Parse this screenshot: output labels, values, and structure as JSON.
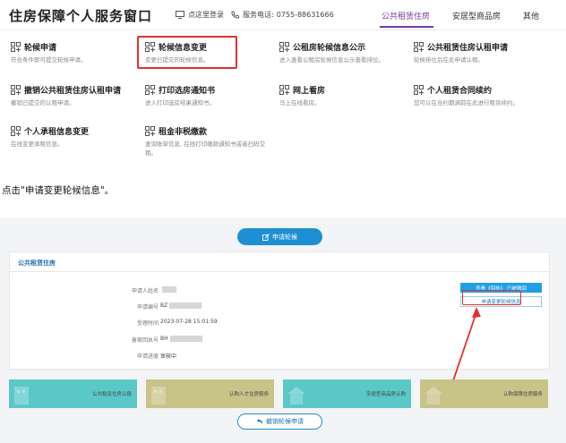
{
  "header": {
    "site_title": "住房保障个人服务窗口",
    "login_label": "点这里登录",
    "phone_label": "服务电话:",
    "phone_number": "0755-88631666",
    "tabs": [
      {
        "label": "公共租赁住房",
        "active": true
      },
      {
        "label": "安居型商品房",
        "active": false
      },
      {
        "label": "其他",
        "active": false
      }
    ]
  },
  "services": [
    {
      "title": "轮候申请",
      "desc": "符合条件即可提交轮候申请。"
    },
    {
      "title": "轮候信息变更",
      "desc": "变更已提交的轮候信息。"
    },
    {
      "title": "公租房轮候信息公示",
      "desc": "进入查看公租房轮候信息公示查看排位。"
    },
    {
      "title": "公共租赁住房认租申请",
      "desc": "轮候排位后在此申请认租。"
    },
    {
      "title": "撤销公共租赁住房认租申请",
      "desc": "撤销已提交的认租申请。"
    },
    {
      "title": "打印选房通知书",
      "desc": "进入打印选房结果通知书。"
    },
    {
      "title": "网上看房",
      "desc": "马上在线看房。"
    },
    {
      "title": "个人租赁合同续约",
      "desc": "您可以在合约期满前在此进行租赁续约。"
    },
    {
      "title": "个人承租信息变更",
      "desc": "在线变更承租信息。"
    },
    {
      "title": "租金非税缴款",
      "desc": "查询账单信息, 在线打印缴款通知书或者扫码交租。"
    }
  ],
  "instruction": "点击\"申请变更轮候信息\"。",
  "lower": {
    "apply_label": "申请轮候",
    "card_title": "公共租赁住房",
    "fields": [
      {
        "label": "申请人姓名",
        "value": ""
      },
      {
        "label": "申请编号",
        "value": "BZ"
      },
      {
        "label": "受理时间",
        "value": "2023-07-28 15:01:59"
      },
      {
        "label": "备案回执号",
        "value": "BH"
      },
      {
        "label": "申请进度",
        "value": "审核中"
      }
    ],
    "query_label": "查看《回执》 已被撤回",
    "change_label": "申请变更轮候信息",
    "tiles": [
      {
        "label": "公共租赁住房认租",
        "color": "#5bc8c8"
      },
      {
        "label": "认购人才住房服务",
        "color": "#c8c387"
      },
      {
        "label": "安居型商品房认购",
        "color": "#5bc8c8"
      },
      {
        "label": "认购保障住房服务",
        "color": "#c8c387"
      }
    ],
    "cancel_label": "撤销轮候申请"
  },
  "colors": {
    "accent_purple": "#7a3aa0",
    "primary_blue": "#1f8fd3",
    "highlight_red": "#e0322d"
  }
}
